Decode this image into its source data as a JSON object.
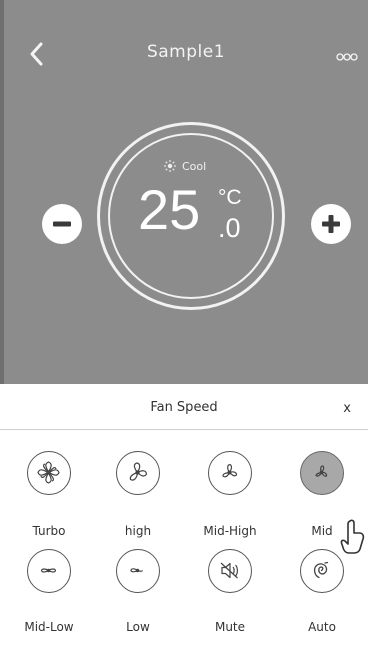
{
  "header": {
    "title": "Sample1"
  },
  "icons": {
    "back": "chevron-left-icon",
    "more": "more-dots-icon",
    "mode": "sun-icon",
    "minus": "minus-icon",
    "plus": "plus-icon",
    "pointer": "hand-pointer-icon"
  },
  "status": {
    "mode_label": "Cool"
  },
  "temperature": {
    "whole": "25",
    "unit": "°C",
    "decimal": ".0"
  },
  "panel": {
    "title": "Fan Speed",
    "close_label": "x"
  },
  "fan_speeds": [
    {
      "label": "Turbo",
      "icon": "fan-turbo-icon"
    },
    {
      "label": "high",
      "icon": "fan-high-icon"
    },
    {
      "label": "Mid-High",
      "icon": "fan-mid-high-icon"
    },
    {
      "label": "Mid",
      "icon": "fan-mid-icon",
      "selected": true
    },
    {
      "label": "Mid-Low",
      "icon": "fan-mid-low-icon"
    },
    {
      "label": "Low",
      "icon": "fan-low-icon"
    },
    {
      "label": "Mute",
      "icon": "mute-icon"
    },
    {
      "label": "Auto",
      "icon": "auto-icon"
    }
  ],
  "colors": {
    "top_background": "#8c8c8c",
    "selected_fill": "#a8a8a8",
    "text": "#333333"
  }
}
